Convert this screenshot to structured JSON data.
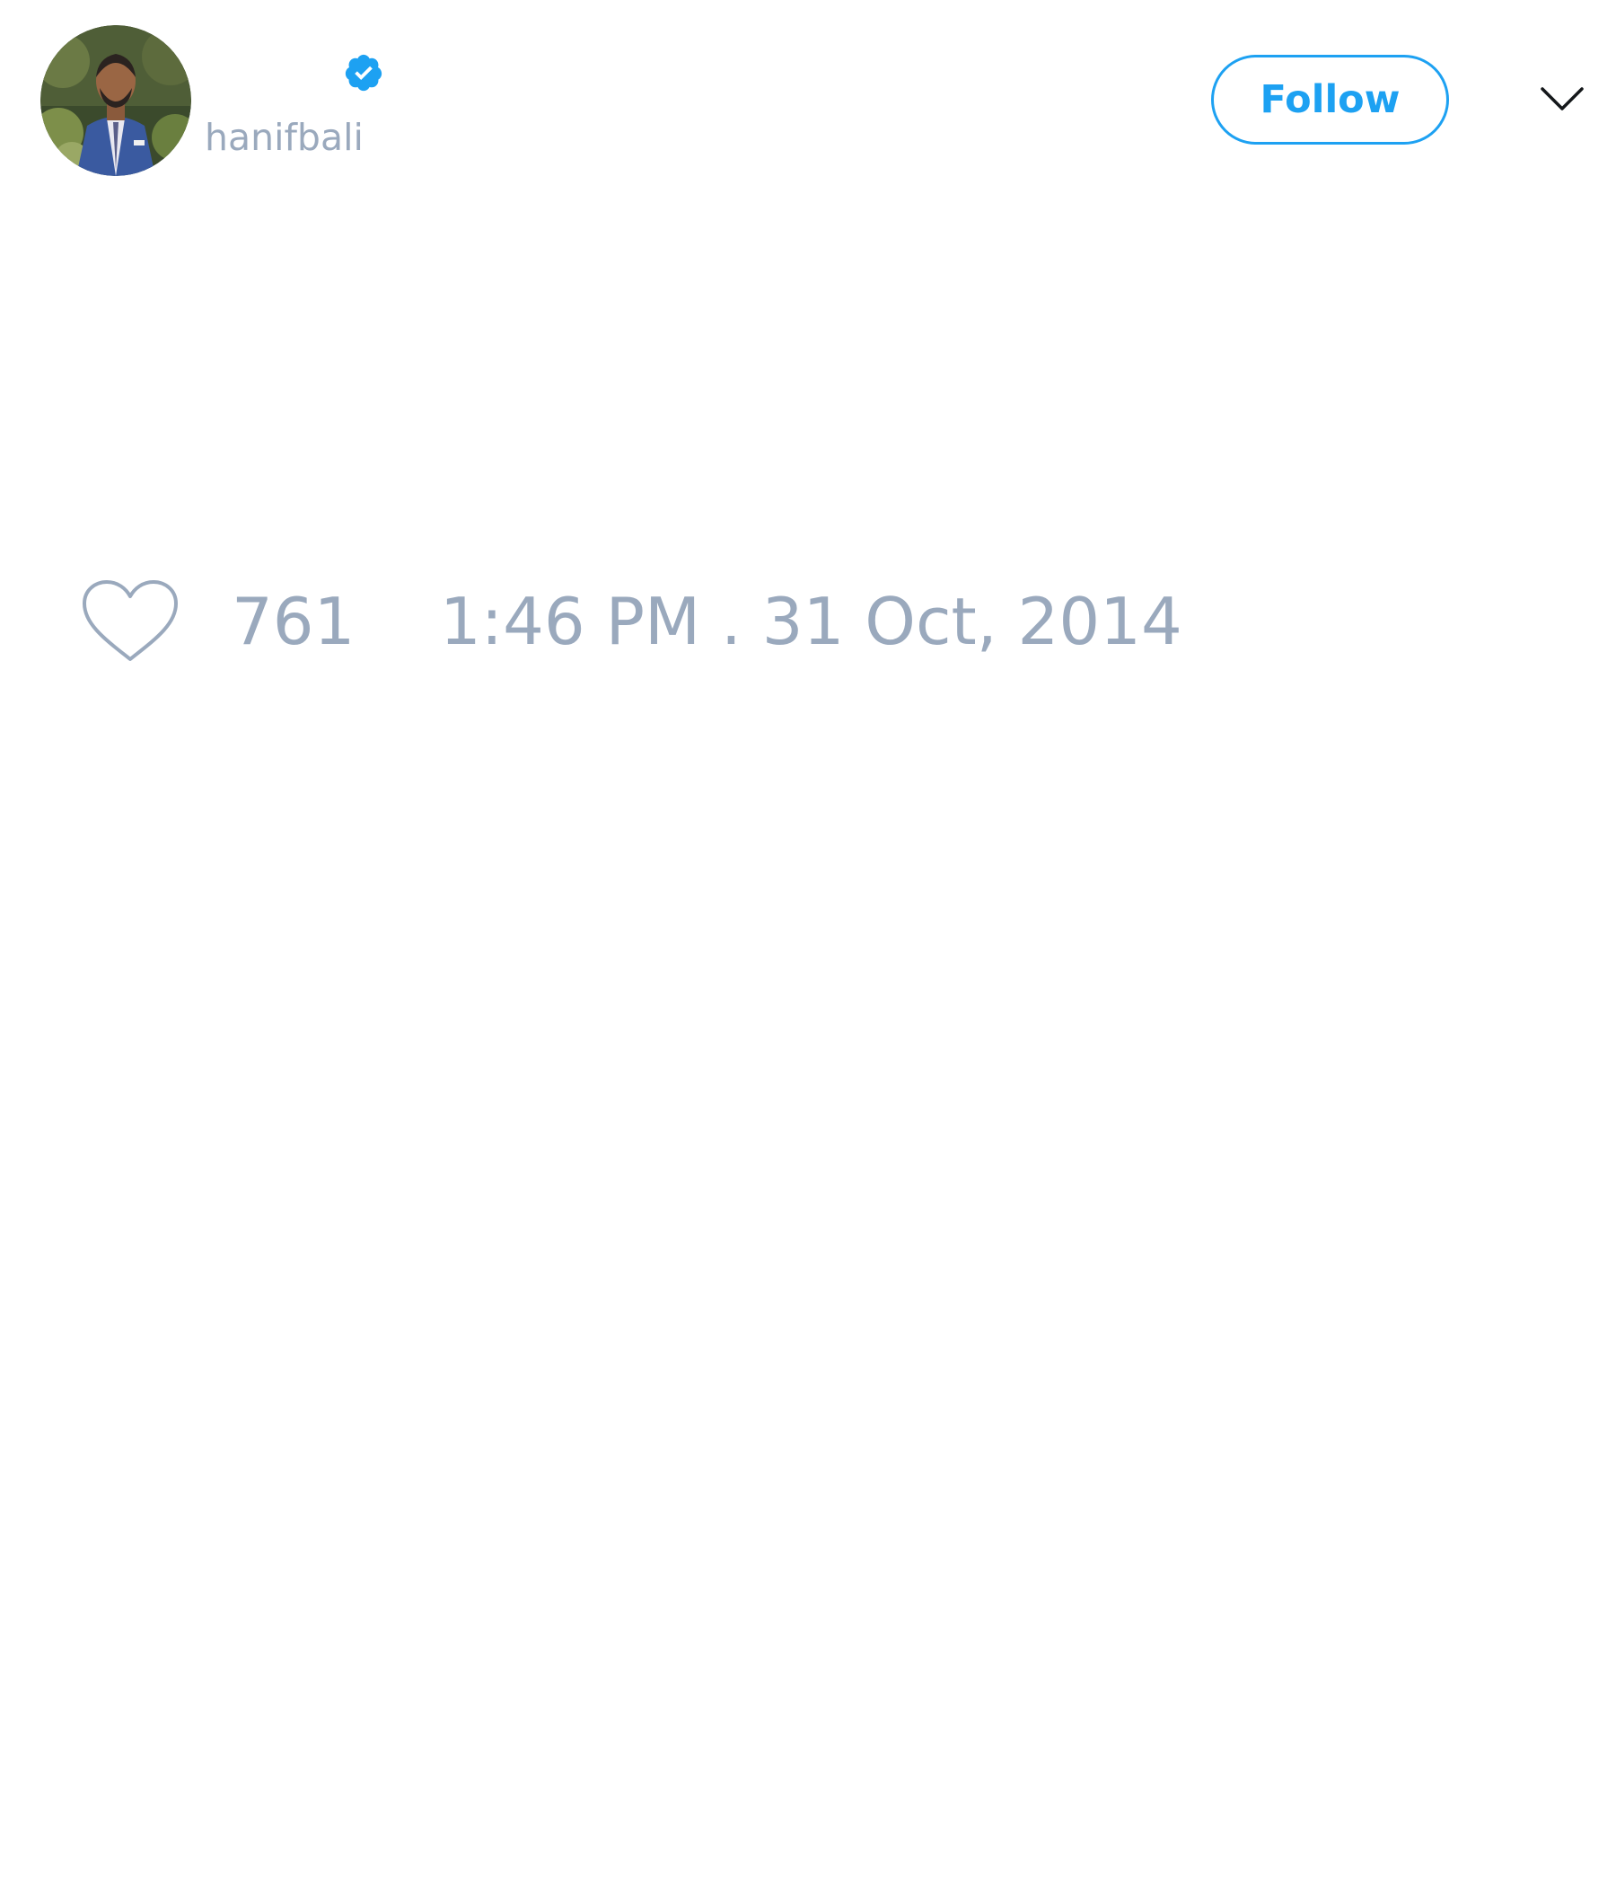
{
  "tweet": {
    "author": {
      "username": "hanifbali",
      "verified": true,
      "avatar_icon": "profile-photo"
    },
    "follow_label": "Follow",
    "menu_icon": "chevron-down-icon",
    "likes": {
      "icon": "heart-icon",
      "count": "761"
    },
    "timestamp": "1:46 PM . 31 Oct, 2014"
  },
  "colors": {
    "accent": "#1da1f2",
    "muted_text": "#9aa9bd",
    "background": "#ffffff"
  }
}
